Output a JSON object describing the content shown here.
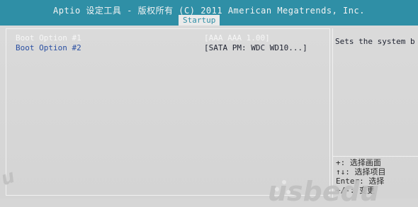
{
  "header": {
    "title": "Aptio 设定工具 - 版权所有 (C) 2011 American Megatrends, Inc.",
    "active_tab": "Startup"
  },
  "boot_options": [
    {
      "label": "Boot Option #1",
      "value": "[AAA AAA 1.00]"
    },
    {
      "label": "Boot Option #2",
      "value": "[SATA  PM: WDC WD10...]"
    }
  ],
  "help": {
    "text": "Sets the system b"
  },
  "keys": [
    "+: 选择画面",
    "↑↓: 选择项目",
    "Enter: 选择",
    "+/-: 变更"
  ],
  "watermark": {
    "left": "u",
    "right": "usbedu"
  },
  "colors": {
    "header_bg": "#2f8fa6",
    "panel_bg": "#d6d6d6",
    "label_color": "#2a4fa2",
    "selected_text": "#f7f7f7"
  }
}
